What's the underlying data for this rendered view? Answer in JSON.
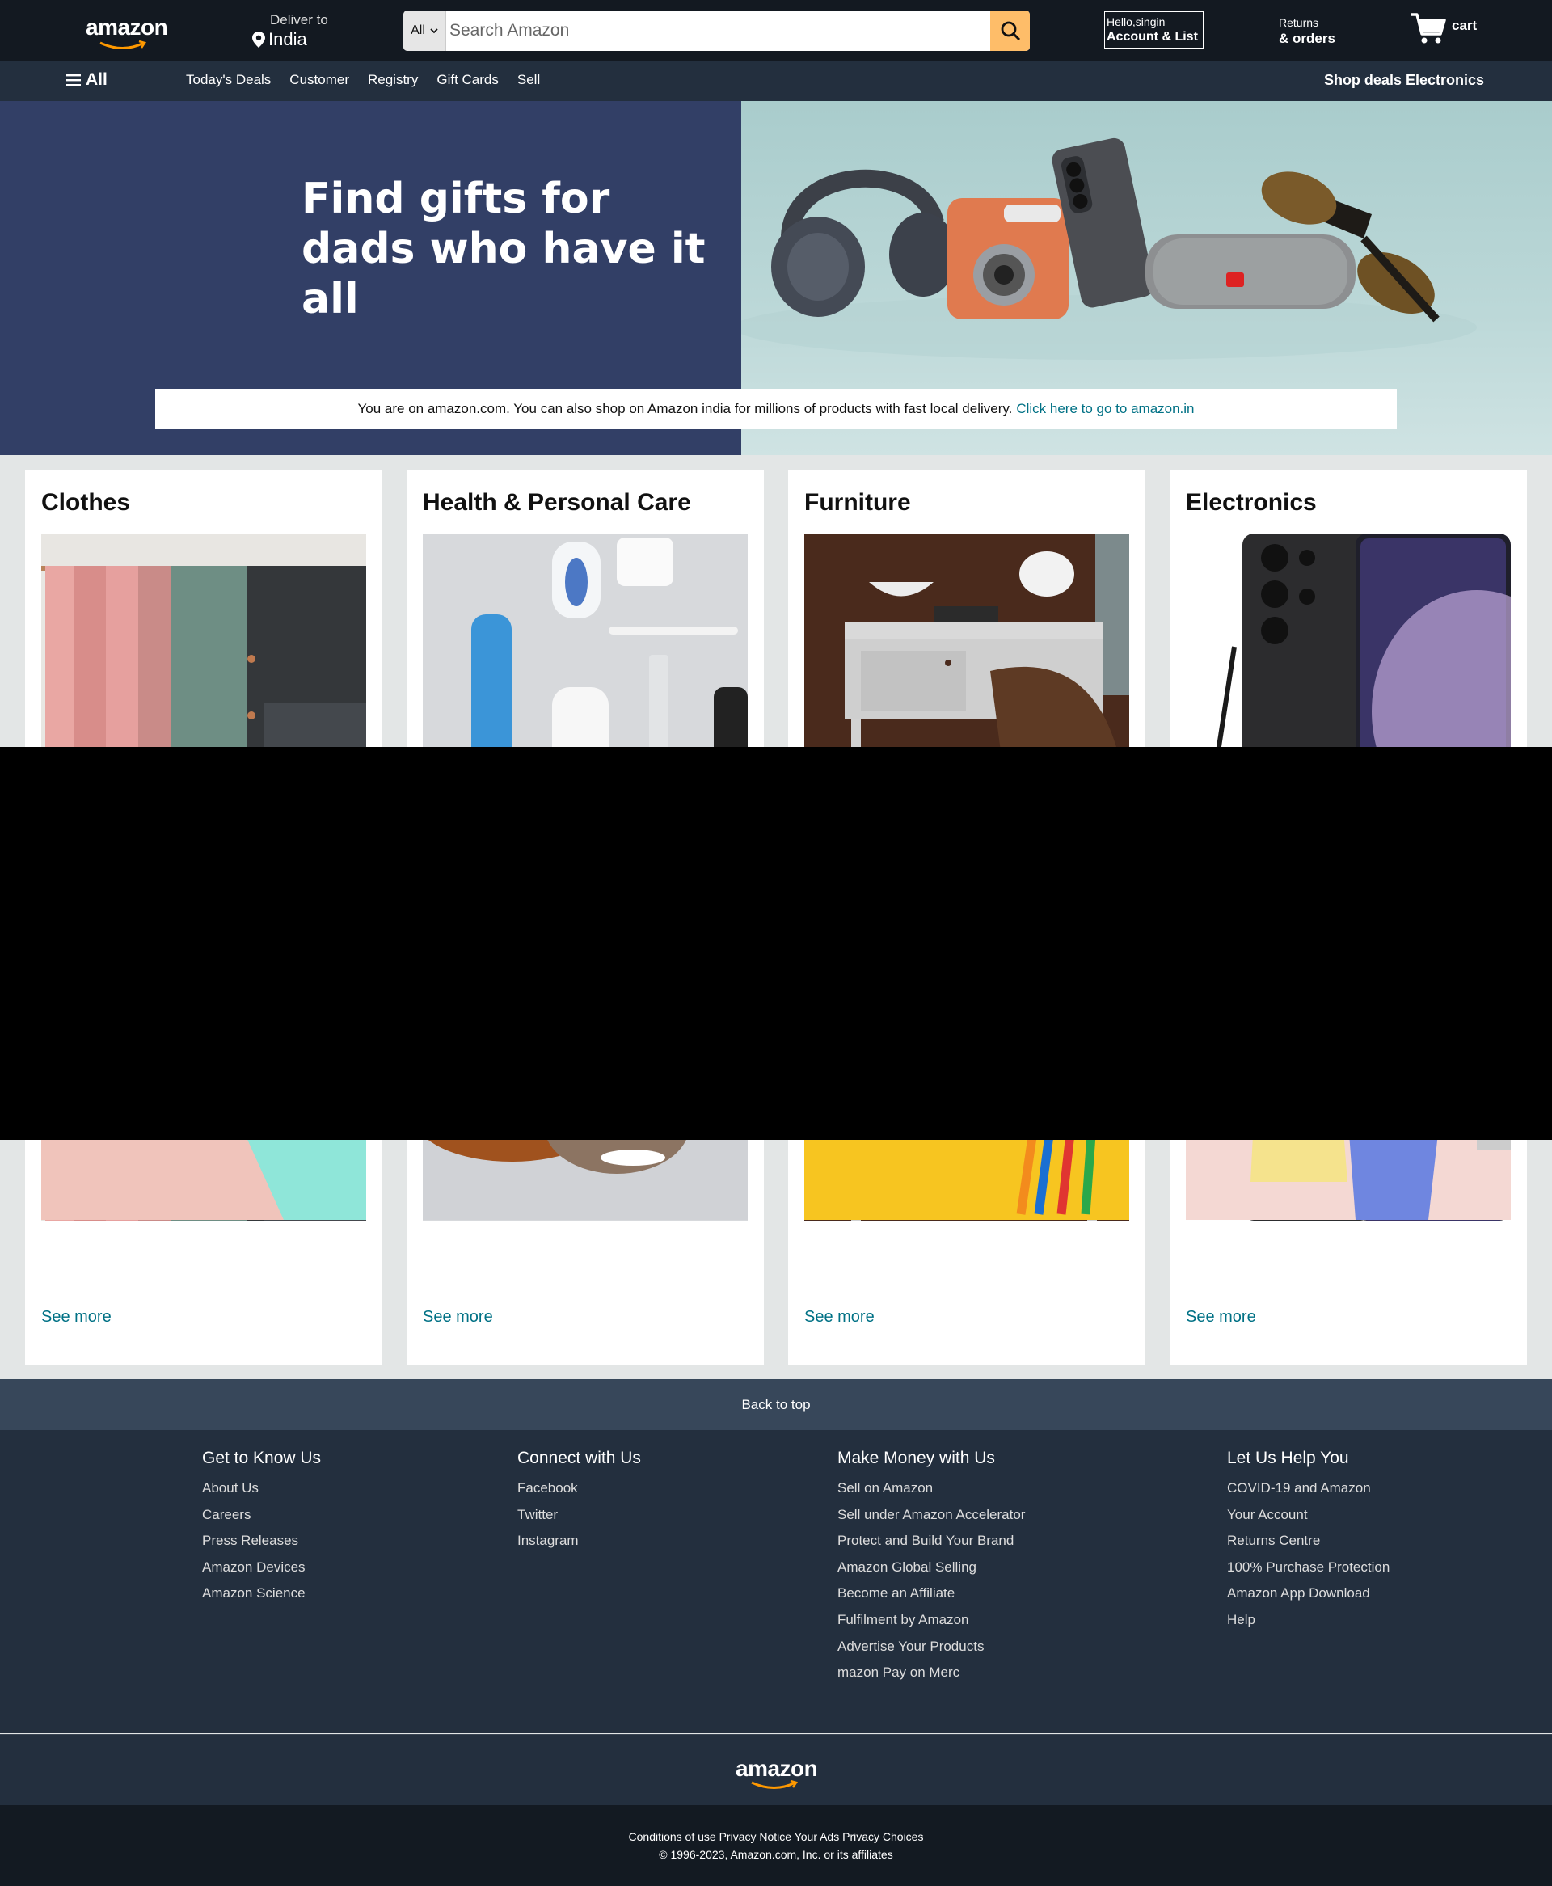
{
  "header": {
    "logo": "amazon",
    "deliver_label": "Deliver to",
    "deliver_location": "India",
    "search_category": "All",
    "search_placeholder": "Search Amazon",
    "account_greeting": "Hello,singin",
    "account_label": "Account & List",
    "returns_label": "Returns",
    "orders_label": "& orders",
    "cart_label": "cart"
  },
  "subnav": {
    "all_label": "All",
    "links": [
      "Today's Deals",
      "Customer",
      "Registry",
      "Gift Cards",
      "Sell"
    ],
    "promo": "Shop deals Electronics"
  },
  "hero": {
    "title_line1": "Find gifts for",
    "title_line2": "dads who have it all",
    "notice_text": "You are on amazon.com. You can also shop on Amazon india for millions of products with fast local delivery.",
    "notice_link": "Click here to go to amazon.in"
  },
  "cards": [
    {
      "title": "Clothes",
      "see_more": "See more"
    },
    {
      "title": "Health & Personal Care",
      "see_more": "See more"
    },
    {
      "title": "Furniture",
      "see_more": "See more"
    },
    {
      "title": "Electronics",
      "see_more": "See more"
    }
  ],
  "footer": {
    "back_to_top": "Back to top",
    "columns": [
      {
        "heading": "Get to Know Us",
        "links": [
          "About Us",
          "Careers",
          "Press Releases",
          "Amazon Devices",
          "Amazon Science"
        ]
      },
      {
        "heading": "Connect with Us",
        "links": [
          "Facebook",
          "Twitter",
          "Instagram"
        ]
      },
      {
        "heading": "Make Money with Us",
        "links": [
          "Sell on Amazon",
          "Sell under Amazon Accelerator",
          "Protect and Build Your Brand",
          "Amazon Global Selling",
          "Become an Affiliate",
          "Fulfilment by Amazon",
          "Advertise Your Products",
          "mazon Pay on Merc"
        ]
      },
      {
        "heading": "Let Us Help You",
        "links": [
          "COVID-19 and Amazon",
          "Your Account",
          "Returns Centre",
          "100% Purchase Protection",
          "Amazon App Download",
          "Help"
        ]
      }
    ],
    "logo": "amazon",
    "legal_links": "Conditions of use Privacy Notice Your Ads Privacy Choices",
    "copyright": "© 1996-2023, Amazon.com, Inc. or its affiliates"
  },
  "colors": {
    "topbar": "#131921",
    "subnav": "#232f3e",
    "search_button": "#febd69",
    "link": "#007185",
    "hero_left": "#323f66"
  }
}
